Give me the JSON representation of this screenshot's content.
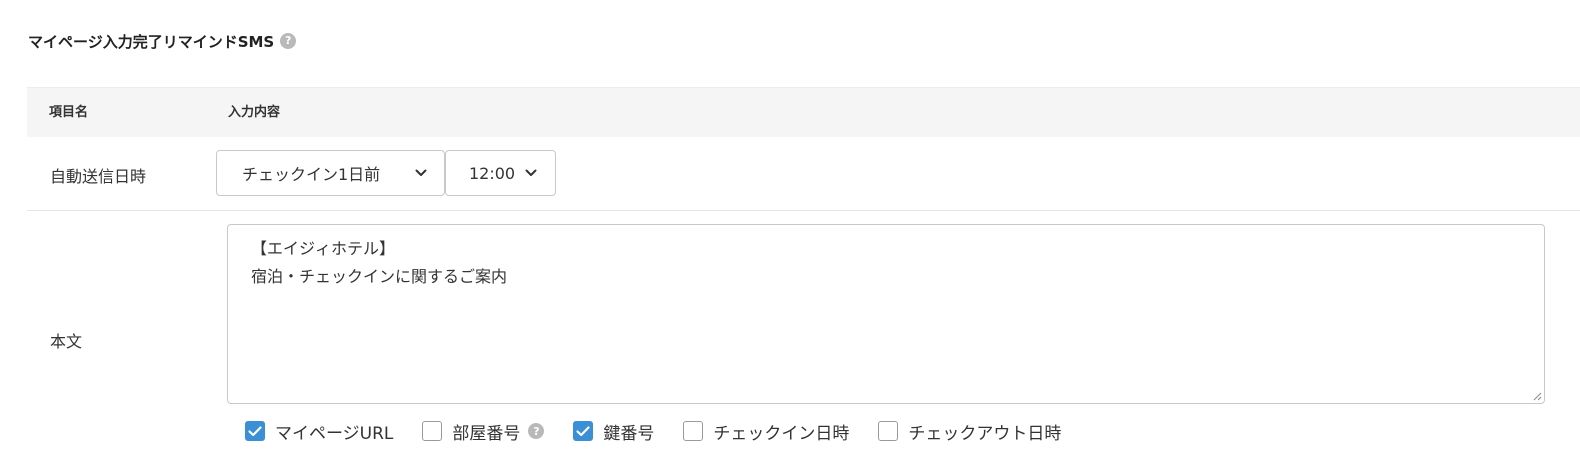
{
  "section": {
    "title": "マイページ入力完了リマインドSMS",
    "help_icon": "?"
  },
  "table": {
    "header_name": "項目名",
    "header_content": "入力内容"
  },
  "send_time": {
    "label": "自動送信日時",
    "day_select": {
      "value": "チェックイン1日前"
    },
    "time_select": {
      "value": "12:00"
    }
  },
  "body": {
    "label": "本文",
    "lines": [
      "【エイジィホテル】",
      "宿泊・チェックインに関するご案内"
    ]
  },
  "insert_options": [
    {
      "label": "マイページURL",
      "checked": true,
      "help": ""
    },
    {
      "label": "部屋番号",
      "checked": false,
      "help": "?"
    },
    {
      "label": "鍵番号",
      "checked": true,
      "help": ""
    },
    {
      "label": "チェックイン日時",
      "checked": false,
      "help": ""
    },
    {
      "label": "チェックアウト日時",
      "checked": false,
      "help": ""
    }
  ],
  "colors": {
    "accent": "#3a8fd6",
    "header_bg": "#f5f5f5",
    "border": "#c9c9c9"
  }
}
